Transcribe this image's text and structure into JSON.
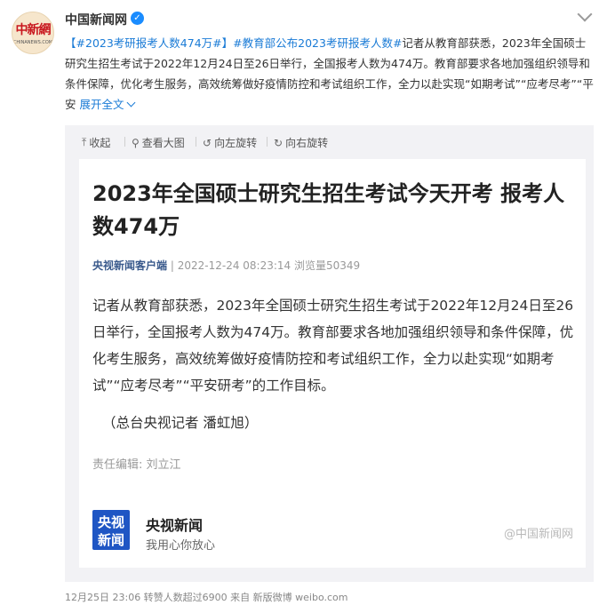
{
  "author": {
    "name": "中国新闻网",
    "avatar_text": "中新網",
    "avatar_subtext": "CHINANEWS.COM"
  },
  "post": {
    "bracket_open": "【",
    "hashtag_1": "#2023考研报考人数474万#",
    "bracket_close": "】",
    "hashtag_2": "#教育部公布2023考研报考人数#",
    "text": "记者从教育部获悉，2023年全国硕士研究生招生考试于2022年12月24日至26日举行，全国报考人数为474万。教育部要求各地加强组织领导和条件保障，优化考生服务，高效统筹做好疫情防控和考试组织工作，全力以赴实现“如期考试”“应考尽考”“平安",
    "expand_label": "展开全文"
  },
  "toolbar": {
    "collapse": "收起",
    "view_large": "查看大图",
    "rotate_left": "向左旋转",
    "rotate_right": "向右旋转"
  },
  "article": {
    "headline": "2023年全国硕士研究生招生考试今天开考 报考人数474万",
    "source": "央视新闻客户端",
    "separator": "|",
    "datetime": "2022-12-24 08:23:14",
    "views": "浏览量50349",
    "body": "记者从教育部获悉，2023年全国硕士研究生招生考试于2022年12月24日至26日举行，全国报考人数为474万。教育部要求各地加强组织领导和条件保障，优化考生服务，高效统筹做好疫情防控和考试组织工作，全力以赴实现“如期考试”“应考尽考”“平安研考”的工作目标。",
    "byline": "（总台央视记者 潘虹旭）",
    "editor": "责任编辑:  刘立江",
    "logo_line1": "央视",
    "logo_line2": "新闻",
    "brand_name": "央视新闻",
    "brand_slogan": "我用心你放心",
    "watermark": "@中国新闻网"
  },
  "footer": {
    "text": "12月25日 23:06 转赞人数超过6900  来自 新版微博 weibo.com"
  }
}
